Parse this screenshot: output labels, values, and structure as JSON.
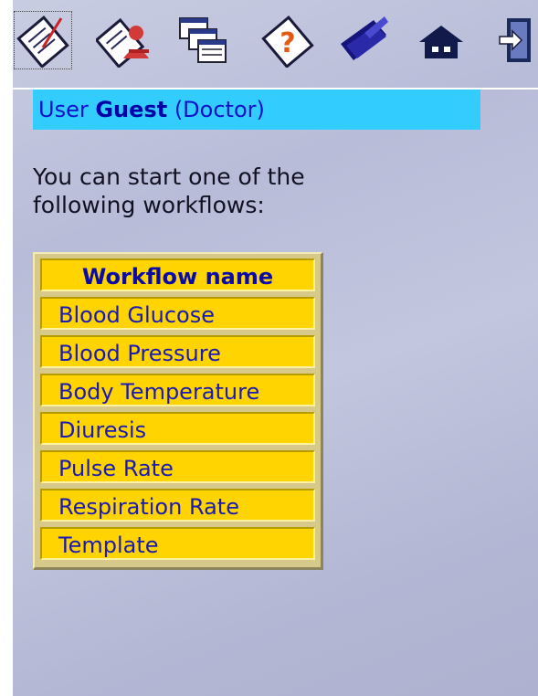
{
  "toolbar": {
    "icons": [
      "checklist-pen-icon",
      "doctor-checklist-icon",
      "windows-icon",
      "help-icon",
      "folder-icon",
      "home-icon",
      "exit-icon"
    ]
  },
  "user": {
    "prefix": "User",
    "name": "Guest",
    "role": "(Doctor)"
  },
  "intro_text": "You can start one of the following workflows:",
  "workflows": {
    "header": "Workflow name",
    "items": [
      "Blood Glucose",
      "Blood Pressure",
      "Body Temperature",
      "Diuresis",
      "Pulse Rate",
      "Respiration Rate",
      "Template"
    ]
  },
  "colors": {
    "user_bar_bg": "#33ccff",
    "cell_bg": "#ffd400",
    "cell_text": "#1a1ab4"
  }
}
